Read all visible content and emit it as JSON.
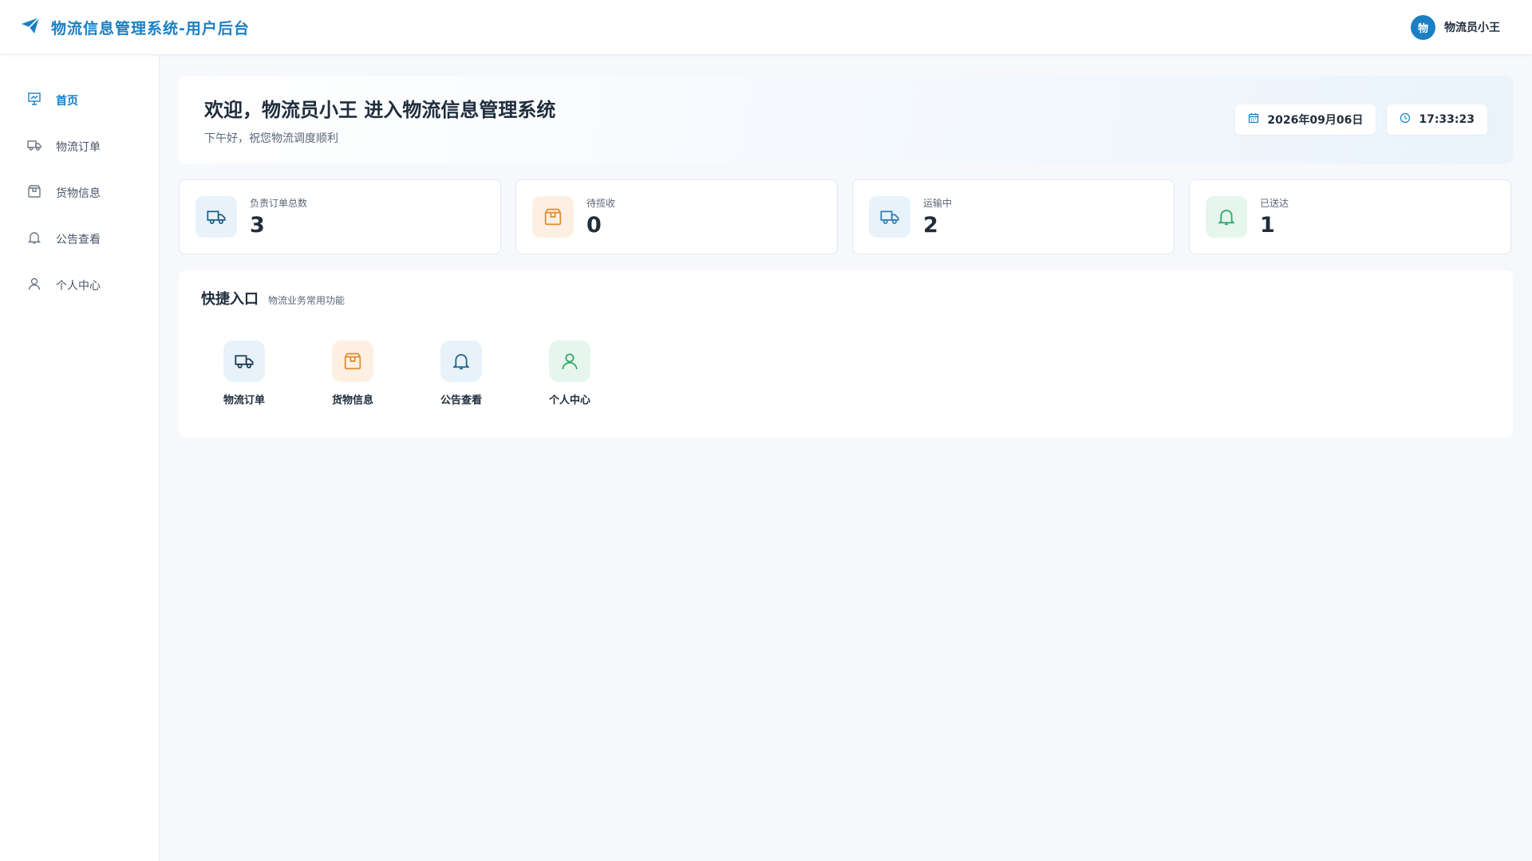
{
  "header": {
    "title": "物流信息管理系统-用户后台",
    "user": {
      "avatar_text": "物",
      "name": "物流员小王"
    },
    "brand_icon": "paper-plane-icon"
  },
  "sidebar": {
    "items": [
      {
        "label": "首页",
        "icon": "home-chart-icon",
        "active": true
      },
      {
        "label": "物流订单",
        "icon": "truck-icon",
        "active": false
      },
      {
        "label": "货物信息",
        "icon": "package-icon",
        "active": false
      },
      {
        "label": "公告查看",
        "icon": "bell-icon",
        "active": false
      },
      {
        "label": "个人中心",
        "icon": "user-icon",
        "active": false
      }
    ]
  },
  "welcome": {
    "title": "欢迎，物流员小王 进入物流信息管理系统",
    "subtitle": "下午好，祝您物流调度顺利",
    "date": "2026年09月06日",
    "time": "17:33:23"
  },
  "stats": [
    {
      "label": "负责订单总数",
      "value": "3",
      "icon": "truck-icon",
      "color": "#1a5f8a"
    },
    {
      "label": "待揽收",
      "value": "0",
      "icon": "package-icon",
      "color": "#e08a2c"
    },
    {
      "label": "运输中",
      "value": "2",
      "icon": "truck-icon",
      "color": "#2f7fb8"
    },
    {
      "label": "已送达",
      "value": "1",
      "icon": "bell-icon",
      "color": "#2aa866"
    }
  ],
  "quick": {
    "title": "快捷入口",
    "subtitle": "物流业务常用功能",
    "items": [
      {
        "label": "物流订单",
        "icon": "truck-icon"
      },
      {
        "label": "货物信息",
        "icon": "package-icon"
      },
      {
        "label": "公告查看",
        "icon": "bell-icon"
      },
      {
        "label": "个人中心",
        "icon": "user-icon"
      }
    ]
  },
  "colors": {
    "accent": "#1a7fc4",
    "orange": "#e08a2c",
    "green": "#2aa866"
  }
}
